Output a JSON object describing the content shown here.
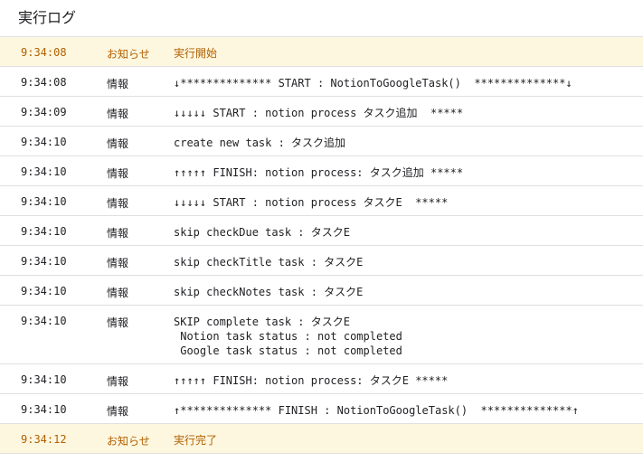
{
  "panel": {
    "title": "実行ログ"
  },
  "rows": [
    {
      "time": "9:34:08",
      "level": "お知らせ",
      "message": "実行開始"
    },
    {
      "time": "9:34:08",
      "level": "情報",
      "message": "↓************** START : NotionToGoogleTask()  **************↓"
    },
    {
      "time": "9:34:09",
      "level": "情報",
      "message": "↓↓↓↓↓ START : notion process タスク追加  *****"
    },
    {
      "time": "9:34:10",
      "level": "情報",
      "message": "create new task : タスク追加"
    },
    {
      "time": "9:34:10",
      "level": "情報",
      "message": "↑↑↑↑↑ FINISH: notion process: タスク追加 *****"
    },
    {
      "time": "9:34:10",
      "level": "情報",
      "message": "↓↓↓↓↓ START : notion process タスクE  *****"
    },
    {
      "time": "9:34:10",
      "level": "情報",
      "message": "skip checkDue task : タスクE"
    },
    {
      "time": "9:34:10",
      "level": "情報",
      "message": "skip checkTitle task : タスクE"
    },
    {
      "time": "9:34:10",
      "level": "情報",
      "message": "skip checkNotes task : タスクE"
    },
    {
      "time": "9:34:10",
      "level": "情報",
      "message": "SKIP complete task : タスクE\n Notion task status : not completed\n Google task status : not completed"
    },
    {
      "time": "9:34:10",
      "level": "情報",
      "message": "↑↑↑↑↑ FINISH: notion process: タスクE *****"
    },
    {
      "time": "9:34:10",
      "level": "情報",
      "message": "↑************** FINISH : NotionToGoogleTask()  **************↑"
    },
    {
      "time": "9:34:12",
      "level": "お知らせ",
      "message": "実行完了"
    }
  ]
}
